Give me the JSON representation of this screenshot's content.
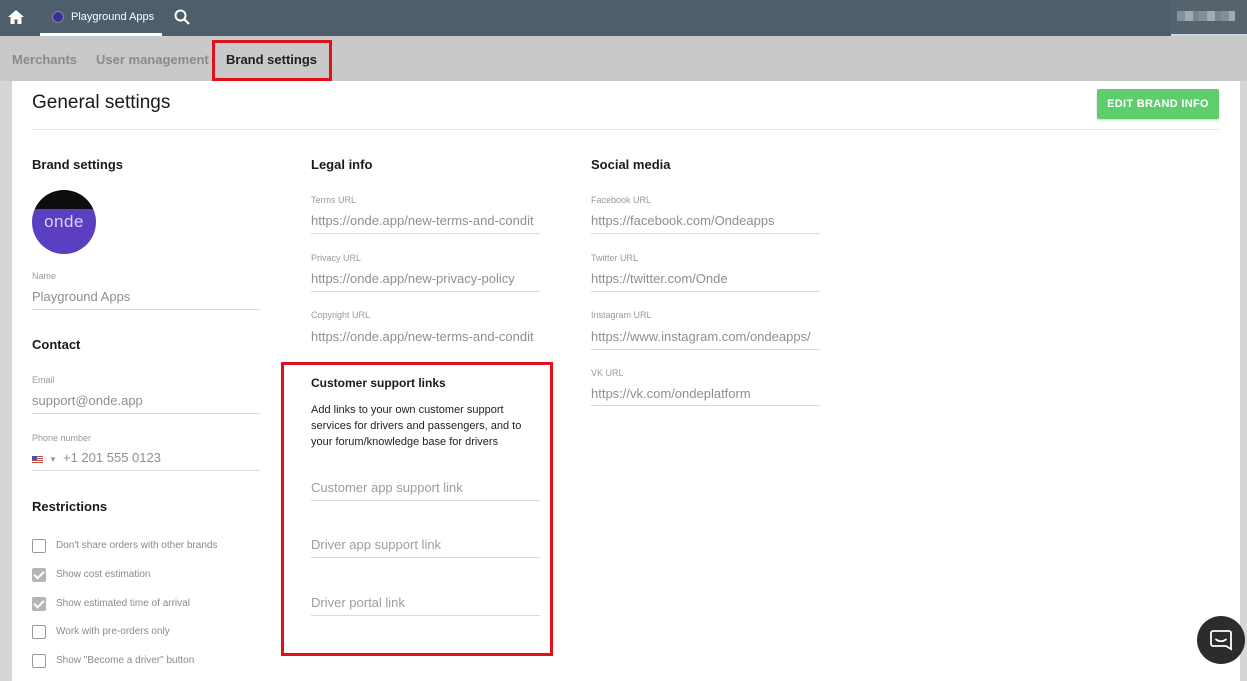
{
  "topbar": {
    "home_icon": "home-icon",
    "app_tab_label": "Playground Apps",
    "search_icon": "search-icon"
  },
  "subnav": {
    "tabs": [
      {
        "label": "Merchants"
      },
      {
        "label": "User management"
      },
      {
        "label": "Brand settings"
      }
    ]
  },
  "page": {
    "title": "General settings",
    "edit_button": "EDIT BRAND INFO"
  },
  "brand": {
    "section_title": "Brand settings",
    "logo_text": "onde",
    "name_label": "Name",
    "name_value": "Playground Apps"
  },
  "contact": {
    "section_title": "Contact",
    "email_label": "Email",
    "email_value": "support@onde.app",
    "phone_label": "Phone number",
    "phone_value": "+1 201 555 0123"
  },
  "restrictions": {
    "section_title": "Restrictions",
    "items": [
      {
        "label": "Don't share orders with other brands",
        "checked": false
      },
      {
        "label": "Show cost estimation",
        "checked": true
      },
      {
        "label": "Show estimated time of arrival",
        "checked": true
      },
      {
        "label": "Work with pre-orders only",
        "checked": false
      },
      {
        "label": "Show \"Become a driver\" button",
        "checked": false
      }
    ]
  },
  "legal": {
    "section_title": "Legal info",
    "terms_label": "Terms URL",
    "terms_value": "https://onde.app/new-terms-and-condit",
    "privacy_label": "Privacy URL",
    "privacy_value": "https://onde.app/new-privacy-policy",
    "copyright_label": "Copyright URL",
    "copyright_value": "https://onde.app/new-terms-and-condit"
  },
  "support": {
    "section_title": "Customer support links",
    "description": "Add links to your own customer support services for drivers and passengers, and to your forum/knowledge base for drivers",
    "customer_placeholder": "Customer app support link",
    "driver_placeholder": "Driver app support link",
    "portal_placeholder": "Driver portal link"
  },
  "social": {
    "section_title": "Social media",
    "facebook_label": "Facebook URL",
    "facebook_value": "https://facebook.com/Ondeapps",
    "twitter_label": "Twitter URL",
    "twitter_value": "https://twitter.com/Onde",
    "instagram_label": "Instagram URL",
    "instagram_value": "https://www.instagram.com/ondeapps/",
    "vk_label": "VK URL",
    "vk_value": "https://vk.com/ondeplatform"
  },
  "colors": {
    "topbar": "#4f5e6b",
    "accent_button": "#5dce6b",
    "highlight": "#e0111a"
  }
}
